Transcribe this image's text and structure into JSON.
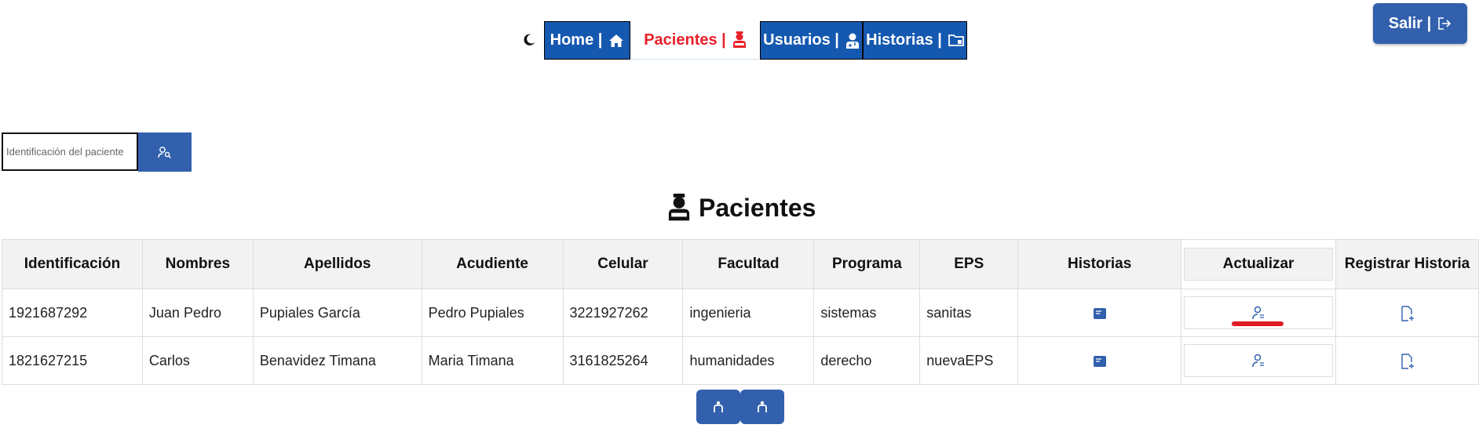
{
  "nav": {
    "home_label": "Home |",
    "pacientes_label": "Pacientes |",
    "usuarios_label": "Usuarios |",
    "historias_label": "Historias |"
  },
  "logout": {
    "label": "Salir |"
  },
  "search": {
    "placeholder": "Identificación del paciente"
  },
  "page_title": "Pacientes",
  "table": {
    "headers": [
      "Identificación",
      "Nombres",
      "Apellidos",
      "Acudiente",
      "Celular",
      "Facultad",
      "Programa",
      "EPS",
      "Historias",
      "Actualizar",
      "Registrar Historia"
    ],
    "rows": [
      {
        "identificacion": "1921687292",
        "nombres": "Juan Pedro",
        "apellidos": "Pupiales García",
        "acudiente": "Pedro Pupiales",
        "celular": "3221927262",
        "facultad": "ingenieria",
        "programa": "sistemas",
        "eps": "sanitas"
      },
      {
        "identificacion": "1821627215",
        "nombres": "Carlos",
        "apellidos": "Benavidez Timana",
        "acudiente": "Maria Timana",
        "celular": "3161825264",
        "facultad": "humanidades",
        "programa": "derecho",
        "eps": "nuevaEPS"
      }
    ]
  },
  "icons": {
    "theme": "moon-icon",
    "home": "house-icon",
    "pacientes": "patient-icon",
    "usuarios": "doctor-icon",
    "historias": "folder-icon",
    "logout": "logout-icon",
    "search": "user-search-icon",
    "historias_row": "book-icon",
    "actualizar_row": "user-edit-icon",
    "registrar_row": "file-plus-icon",
    "prev": "prev-icon",
    "next": "next-icon"
  },
  "colors": {
    "primary": "#1558b0",
    "button": "#3260ad",
    "active": "#e8202a",
    "accent_underline": "#e01b22"
  }
}
